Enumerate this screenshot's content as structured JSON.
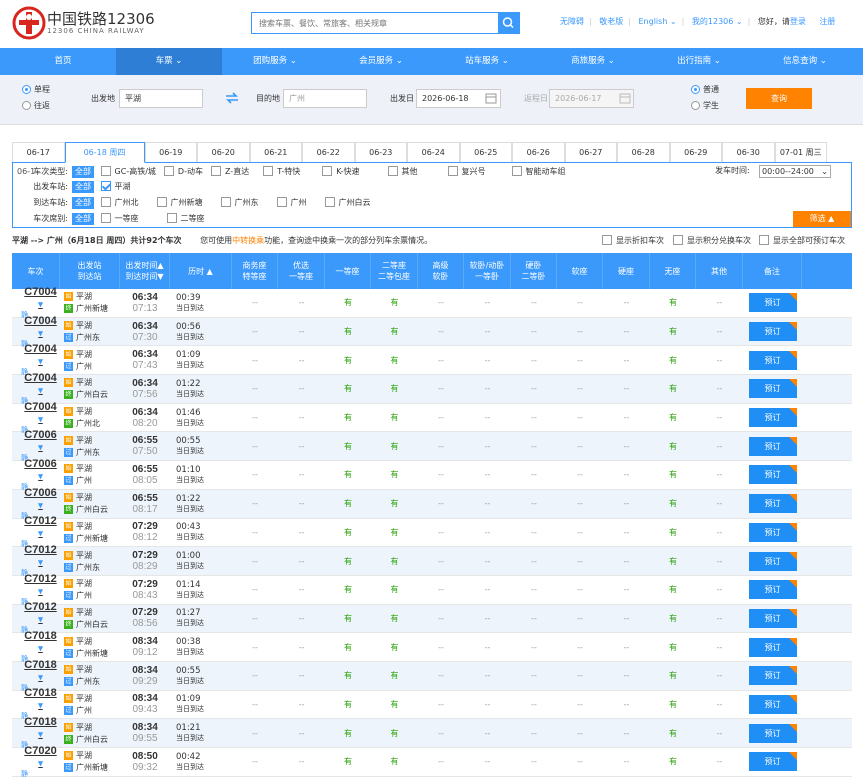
{
  "header": {
    "logo_cn": "中国铁路12306",
    "logo_en": "12306 CHINA RAILWAY",
    "search_placeholder": "搜索车票、餐饮、常旅客、相关规章",
    "links": [
      "无障碍",
      "敬老版",
      "English ⌄",
      "我的12306 ⌄"
    ],
    "greeting": "您好，请",
    "login": "登录",
    "register": "注册"
  },
  "nav": [
    "首页",
    "车票 ⌄",
    "团购服务 ⌄",
    "会员服务 ⌄",
    "站车服务 ⌄",
    "商旅服务 ⌄",
    "出行指南 ⌄",
    "信息查询 ⌄"
  ],
  "query": {
    "trip_one": "单程",
    "trip_round": "往返",
    "from_label": "出发地",
    "from_value": "平湖",
    "to_label": "目的地",
    "to_value": "广州",
    "depart_label": "出发日",
    "depart_value": "2026-06-18",
    "return_label": "返程日",
    "return_value": "2026-06-17",
    "type_normal": "普通",
    "type_student": "学生",
    "query_button": "查询"
  },
  "dates": [
    "06-17",
    "06-18 周四",
    "06-19",
    "06-20",
    "06-21",
    "06-22",
    "06-23",
    "06-24",
    "06-25",
    "06-26",
    "06-27",
    "06-28",
    "06-29",
    "06-30",
    "07-01 周三"
  ],
  "filter": {
    "row1_label": "车次类型:",
    "row1_overlay": "06-1",
    "all": "全部",
    "types": [
      "GC-高铁/城",
      "D-动车",
      "Z-直达",
      "T-特快",
      "K-快速",
      "其他",
      "复兴号",
      "智能动车组"
    ],
    "dep_time_label": "发车时间:",
    "dep_time_value": "00:00--24:00",
    "from_label": "出发车站:",
    "from_stations": [
      "平湖"
    ],
    "to_label": "到达车站:",
    "to_stations": [
      "广州北",
      "广州新塘",
      "广州东",
      "广州",
      "广州白云"
    ],
    "seat_label": "车次席别:",
    "seats": [
      "一等座",
      "二等座"
    ],
    "filter_button": "筛选 ▲"
  },
  "summary": {
    "route": "平湖 --> 广州（6月18日 周四）共计92个车次",
    "tip_pre": "您可使用",
    "tip_link": "中转换乘",
    "tip_post": "功能，查询途中换乘一次的部分列车余票情况。",
    "opt1": "显示折扣车次",
    "opt2": "显示积分兑换车次",
    "opt3": "显示全部可预订车次"
  },
  "table": {
    "headers": [
      [
        "车次"
      ],
      [
        "出发站",
        "到达站"
      ],
      [
        "出发时间▲",
        "到达时间▼"
      ],
      [
        "历时 ▲"
      ],
      [
        "商务座",
        "特等座"
      ],
      [
        "优选",
        "一等座"
      ],
      [
        "一等座"
      ],
      [
        "二等座",
        "二等包座"
      ],
      [
        "高级",
        "软卧"
      ],
      [
        "软卧/动卧",
        "一等卧"
      ],
      [
        "硬卧",
        "二等卧"
      ],
      [
        "软座"
      ],
      [
        "硬座"
      ],
      [
        "无座"
      ],
      [
        "其他"
      ],
      [
        "备注"
      ]
    ],
    "book_label": "预订",
    "rows": [
      {
        "no": "C7004",
        "sub": "静",
        "from": "平湖",
        "to": "广州新塘",
        "fb": "始",
        "tb": "终",
        "dep": "06:34",
        "arr": "07:13",
        "dur": "00:39",
        "day": "当日到达",
        "cells": [
          "--",
          "--",
          "有",
          "有",
          "--",
          "--",
          "--",
          "--",
          "--",
          "有",
          "--"
        ]
      },
      {
        "no": "C7004",
        "sub": "静",
        "from": "平湖",
        "to": "广州东",
        "fb": "始",
        "tb": "过",
        "dep": "06:34",
        "arr": "07:30",
        "dur": "00:56",
        "day": "当日到达",
        "cells": [
          "--",
          "--",
          "有",
          "有",
          "--",
          "--",
          "--",
          "--",
          "--",
          "有",
          "--"
        ]
      },
      {
        "no": "C7004",
        "sub": "静",
        "from": "平湖",
        "to": "广州",
        "fb": "始",
        "tb": "过",
        "dep": "06:34",
        "arr": "07:43",
        "dur": "01:09",
        "day": "当日到达",
        "cells": [
          "--",
          "--",
          "有",
          "有",
          "--",
          "--",
          "--",
          "--",
          "--",
          "有",
          "--"
        ]
      },
      {
        "no": "C7004",
        "sub": "静",
        "from": "平湖",
        "to": "广州白云",
        "fb": "始",
        "tb": "终",
        "dep": "06:34",
        "arr": "07:56",
        "dur": "01:22",
        "day": "当日到达",
        "cells": [
          "--",
          "--",
          "有",
          "有",
          "--",
          "--",
          "--",
          "--",
          "--",
          "有",
          "--"
        ]
      },
      {
        "no": "C7004",
        "sub": "静",
        "from": "平湖",
        "to": "广州北",
        "fb": "始",
        "tb": "终",
        "dep": "06:34",
        "arr": "08:20",
        "dur": "01:46",
        "day": "当日到达",
        "cells": [
          "--",
          "--",
          "有",
          "有",
          "--",
          "--",
          "--",
          "--",
          "--",
          "有",
          "--"
        ]
      },
      {
        "no": "C7006",
        "sub": "静",
        "from": "平湖",
        "to": "广州东",
        "fb": "始",
        "tb": "过",
        "dep": "06:55",
        "arr": "07:50",
        "dur": "00:55",
        "day": "当日到达",
        "cells": [
          "--",
          "--",
          "有",
          "有",
          "--",
          "--",
          "--",
          "--",
          "--",
          "有",
          "--"
        ]
      },
      {
        "no": "C7006",
        "sub": "静",
        "from": "平湖",
        "to": "广州",
        "fb": "始",
        "tb": "过",
        "dep": "06:55",
        "arr": "08:05",
        "dur": "01:10",
        "day": "当日到达",
        "cells": [
          "--",
          "--",
          "有",
          "有",
          "--",
          "--",
          "--",
          "--",
          "--",
          "有",
          "--"
        ]
      },
      {
        "no": "C7006",
        "sub": "静",
        "from": "平湖",
        "to": "广州白云",
        "fb": "始",
        "tb": "终",
        "dep": "06:55",
        "arr": "08:17",
        "dur": "01:22",
        "day": "当日到达",
        "cells": [
          "--",
          "--",
          "有",
          "有",
          "--",
          "--",
          "--",
          "--",
          "--",
          "有",
          "--"
        ]
      },
      {
        "no": "C7012",
        "sub": "静",
        "from": "平湖",
        "to": "广州新塘",
        "fb": "始",
        "tb": "过",
        "dep": "07:29",
        "arr": "08:12",
        "dur": "00:43",
        "day": "当日到达",
        "cells": [
          "--",
          "--",
          "有",
          "有",
          "--",
          "--",
          "--",
          "--",
          "--",
          "有",
          "--"
        ]
      },
      {
        "no": "C7012",
        "sub": "静",
        "from": "平湖",
        "to": "广州东",
        "fb": "始",
        "tb": "过",
        "dep": "07:29",
        "arr": "08:29",
        "dur": "01:00",
        "day": "当日到达",
        "cells": [
          "--",
          "--",
          "有",
          "有",
          "--",
          "--",
          "--",
          "--",
          "--",
          "有",
          "--"
        ]
      },
      {
        "no": "C7012",
        "sub": "静",
        "from": "平湖",
        "to": "广州",
        "fb": "始",
        "tb": "过",
        "dep": "07:29",
        "arr": "08:43",
        "dur": "01:14",
        "day": "当日到达",
        "cells": [
          "--",
          "--",
          "有",
          "有",
          "--",
          "--",
          "--",
          "--",
          "--",
          "有",
          "--"
        ]
      },
      {
        "no": "C7012",
        "sub": "静",
        "from": "平湖",
        "to": "广州白云",
        "fb": "始",
        "tb": "终",
        "dep": "07:29",
        "arr": "08:56",
        "dur": "01:27",
        "day": "当日到达",
        "cells": [
          "--",
          "--",
          "有",
          "有",
          "--",
          "--",
          "--",
          "--",
          "--",
          "有",
          "--"
        ]
      },
      {
        "no": "C7018",
        "sub": "静",
        "from": "平湖",
        "to": "广州新塘",
        "fb": "始",
        "tb": "过",
        "dep": "08:34",
        "arr": "09:12",
        "dur": "00:38",
        "day": "当日到达",
        "cells": [
          "--",
          "--",
          "有",
          "有",
          "--",
          "--",
          "--",
          "--",
          "--",
          "有",
          "--"
        ]
      },
      {
        "no": "C7018",
        "sub": "静",
        "from": "平湖",
        "to": "广州东",
        "fb": "始",
        "tb": "过",
        "dep": "08:34",
        "arr": "09:29",
        "dur": "00:55",
        "day": "当日到达",
        "cells": [
          "--",
          "--",
          "有",
          "有",
          "--",
          "--",
          "--",
          "--",
          "--",
          "有",
          "--"
        ]
      },
      {
        "no": "C7018",
        "sub": "静",
        "from": "平湖",
        "to": "广州",
        "fb": "始",
        "tb": "过",
        "dep": "08:34",
        "arr": "09:43",
        "dur": "01:09",
        "day": "当日到达",
        "cells": [
          "--",
          "--",
          "有",
          "有",
          "--",
          "--",
          "--",
          "--",
          "--",
          "有",
          "--"
        ]
      },
      {
        "no": "C7018",
        "sub": "静",
        "from": "平湖",
        "to": "广州白云",
        "fb": "始",
        "tb": "终",
        "dep": "08:34",
        "arr": "09:55",
        "dur": "01:21",
        "day": "当日到达",
        "cells": [
          "--",
          "--",
          "有",
          "有",
          "--",
          "--",
          "--",
          "--",
          "--",
          "有",
          "--"
        ]
      },
      {
        "no": "C7020",
        "sub": "静",
        "from": "平湖",
        "to": "广州新塘",
        "fb": "始",
        "tb": "过",
        "dep": "08:50",
        "arr": "09:32",
        "dur": "00:42",
        "day": "当日到达",
        "cells": [
          "--",
          "--",
          "有",
          "有",
          "--",
          "--",
          "--",
          "--",
          "--",
          "有",
          "--"
        ]
      }
    ]
  },
  "colors": {
    "primary": "#3b99fc",
    "accent": "#ff8200",
    "available": "#26a306"
  }
}
